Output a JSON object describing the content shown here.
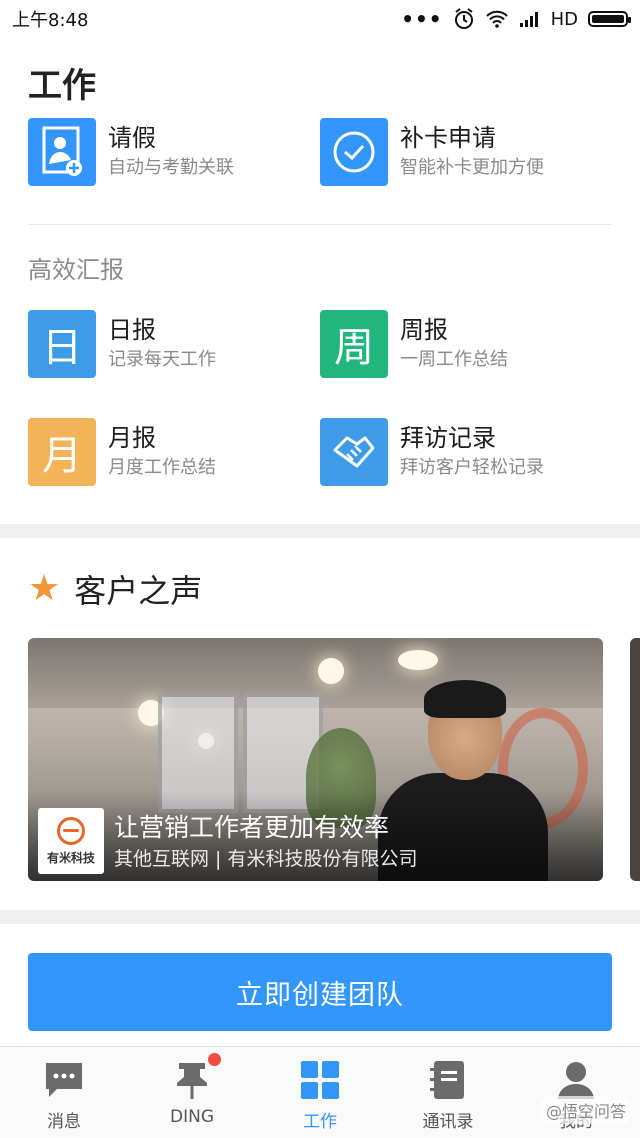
{
  "status_bar": {
    "time": "上午8:48",
    "network": "HD"
  },
  "page_title": "工作",
  "top_apps": [
    {
      "name": "请假",
      "desc": "自动与考勤关联",
      "icon": "leave-request-icon",
      "color": "#3296fa"
    },
    {
      "name": "补卡申请",
      "desc": "智能补卡更加方便",
      "icon": "clock-icon",
      "color": "#3296fa"
    }
  ],
  "report_section": {
    "label": "高效汇报",
    "apps": [
      {
        "name": "日报",
        "desc": "记录每天工作",
        "glyph": "日",
        "color": "#3e9be8"
      },
      {
        "name": "周报",
        "desc": "一周工作总结",
        "glyph": "周",
        "color": "#22b67f"
      },
      {
        "name": "月报",
        "desc": "月度工作总结",
        "glyph": "月",
        "color": "#f3b358"
      },
      {
        "name": "拜访记录",
        "desc": "拜访客户轻松记录",
        "icon": "handshake-icon",
        "color": "#3e9be8"
      }
    ]
  },
  "customer_voice": {
    "title": "客户之声",
    "card": {
      "title": "让营销工作者更加有效率",
      "subtitle": "其他互联网 | 有米科技股份有限公司",
      "logo_text": "有米科技"
    }
  },
  "cta_label": "立即创建团队",
  "tabs": [
    {
      "label": "消息",
      "icon": "message-icon",
      "active": false
    },
    {
      "label": "DING",
      "icon": "pin-icon",
      "active": false,
      "badge": true
    },
    {
      "label": "工作",
      "icon": "grid-icon",
      "active": true
    },
    {
      "label": "通讯录",
      "icon": "contacts-icon",
      "active": false
    },
    {
      "label": "我的",
      "icon": "user-icon",
      "active": false
    }
  ],
  "watermark": "@悟空问答"
}
